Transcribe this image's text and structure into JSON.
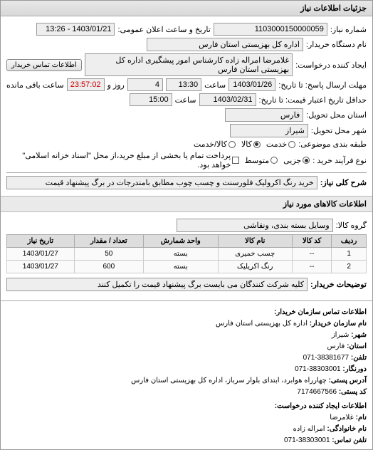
{
  "title": "جزئیات اطلاعات نیاز",
  "fields": {
    "number_label": "شماره نیاز:",
    "number": "1103000150000059",
    "announce_label": "تاریخ و ساعت اعلان عمومی:",
    "announce": "1403/01/21 - 13:26",
    "buyer_label": "نام دستگاه خریدار:",
    "buyer": "اداره کل بهزیستی استان فارس",
    "requester_label": "ایجاد کننده درخواست:",
    "requester": "غلامرضا امراله زاده کارشناس امور پیشگیری اداره کل بهزیستی استان فارس",
    "contact_btn": "اطلاعات تماس خریدار",
    "deadline_label": "مهلت ارسال پاسخ: تا تاریخ:",
    "deadline_date": "1403/01/26",
    "time_label": "ساعت",
    "deadline_time": "13:30",
    "remain_days": "4",
    "remain_days_label": "روز و",
    "remain_time": "23:57:02",
    "remain_time_label": "ساعت باقی مانده",
    "validity_label": "حداقل تاریخ اعتبار قیمت: تا تاریخ:",
    "validity_date": "1403/02/31",
    "validity_time": "15:00",
    "province_label": "استان محل تحویل:",
    "province": "فارس",
    "city_label": "شهر محل تحویل:",
    "city": "شیراز",
    "category_label": "طبقه بندی موضوعی:",
    "service_option": "خدمت",
    "goods_option": "کالا",
    "goods_service_option": "کالا/خدمت",
    "purchase_type_label": "نوع فرآیند خرید :",
    "minor_option": "جزیی",
    "medium_option": "متوسط",
    "purchase_note": "پرداخت تمام یا بخشی از مبلغ خرید،از محل \"اسناد خزانه اسلامی\" خواهد بود.",
    "subject_label": "شرح کلی نیاز:",
    "subject": "خرید رنگ اکرولیک فلورسنت و چسب چوب مطابق بامندرجات در برگ پیشنهاد قیمت",
    "goods_header": "اطلاعات کالاهای مورد نیاز",
    "group_label": "گروه کالا:",
    "group": "وسایل بسته بندی، ونقاشی",
    "columns": {
      "row": "ردیف",
      "code": "کد کالا",
      "name": "نام کالا",
      "unit": "واحد شمارش",
      "qty": "تعداد / مقدار",
      "date": "تاریخ نیاز"
    },
    "rows": [
      {
        "n": "1",
        "code": "--",
        "name": "چسب خمیری",
        "unit": "بسته",
        "qty": "50",
        "date": "1403/01/27"
      },
      {
        "n": "2",
        "code": "--",
        "name": "رنگ اکریلیک",
        "unit": "بسته",
        "qty": "600",
        "date": "1403/01/27"
      }
    ],
    "buyer_notes_label": "توضیحات خریدار:",
    "buyer_notes": "کلیه شرکت کنندگان می بایست برگ پیشنهاد قیمت را تکمیل کنند",
    "contact_header": "اطلاعات تماس سازمان خریدار:",
    "org_name_label": "نام سازمان خریدار:",
    "org_name": "اداره کل بهزیستی استان فارس",
    "c_city_label": "شهر:",
    "c_city": "شیراز",
    "c_province_label": "استان:",
    "c_province": "فارس",
    "c_phone_label": "تلفن:",
    "c_phone": "38381677-071",
    "c_fax_label": "دورنگار:",
    "c_fax": "38303001-071",
    "c_postal_label": "آدرس پستی:",
    "c_postal": "چهارراه هوابرد، ابتدای بلوار سرباز، اداره کل بهزیستی استان فارس",
    "c_postcode_label": "کد پستی:",
    "c_postcode": "7174667566",
    "req_header": "اطلاعات ایجاد کننده درخواست:",
    "r_name_label": "نام:",
    "r_name": "غلامرضا",
    "r_family_label": "نام خانوادگی:",
    "r_family": "امراله زاده",
    "r_phone_label": "تلفن تماس:",
    "r_phone": "38303001-071"
  }
}
